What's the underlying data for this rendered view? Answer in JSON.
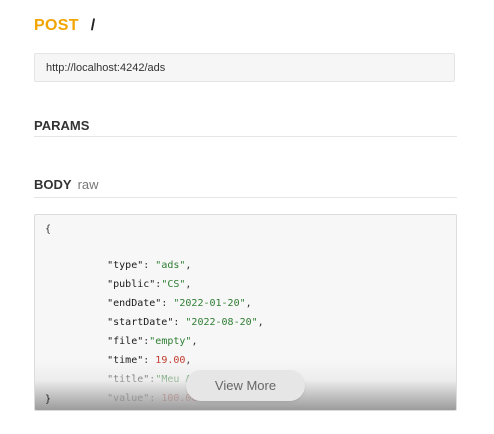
{
  "request": {
    "method": "POST",
    "path": "/",
    "url": "http://localhost:4242/ads"
  },
  "sections": {
    "params_title": "PARAMS",
    "body_title": "BODY",
    "body_type": "raw"
  },
  "code": {
    "open_brace": "{",
    "close_brace": "}",
    "lines": [
      {
        "key": "\"type\"",
        "sep": ": ",
        "value": "\"ads\"",
        "value_kind": "string",
        "trail": ","
      },
      {
        "key": "\"public\"",
        "sep": ":",
        "value": "\"CS\"",
        "value_kind": "string",
        "trail": ","
      },
      {
        "key": "\"endDate\"",
        "sep": ": ",
        "value": "\"2022-01-20\"",
        "value_kind": "string",
        "trail": ","
      },
      {
        "key": "\"startDate\"",
        "sep": ": ",
        "value": "\"2022-08-20\"",
        "value_kind": "string",
        "trail": ","
      },
      {
        "key": "\"file\"",
        "sep": ":",
        "value": "\"empty\"",
        "value_kind": "string",
        "trail": ","
      },
      {
        "key": "\"time\"",
        "sep": ": ",
        "value": "19.00",
        "value_kind": "number",
        "trail": ","
      },
      {
        "key": "\"title\"",
        "sep": ":",
        "value": "\"Meu AD\"",
        "value_kind": "string",
        "trail": ","
      },
      {
        "key": "\"value\"",
        "sep": ": ",
        "value": "100.00",
        "value_kind": "number",
        "trail": ""
      }
    ]
  },
  "view_more_label": "View More",
  "colors": {
    "method": "#f2a500",
    "string": "#2e7d32",
    "number": "#c0392b"
  }
}
